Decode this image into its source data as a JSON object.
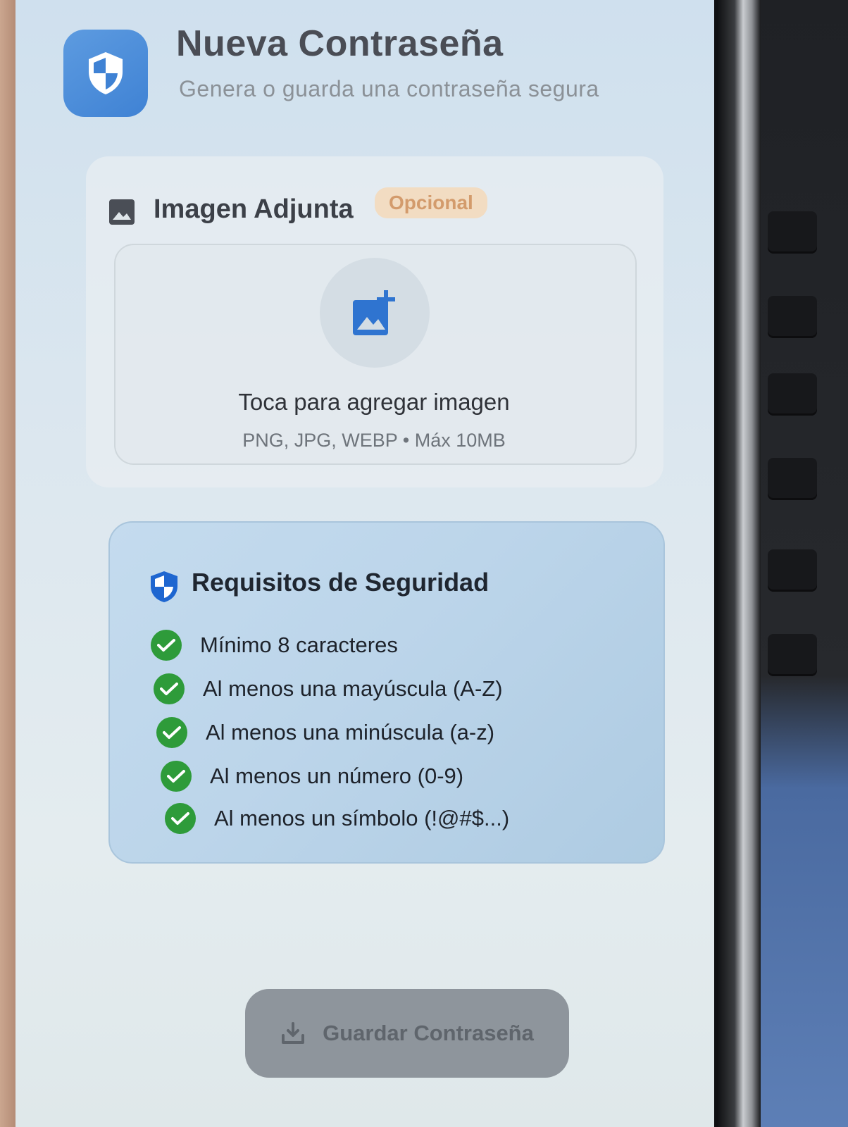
{
  "header": {
    "title": "Nueva Contraseña",
    "subtitle": "Genera o guarda una contraseña segura",
    "icon": "shield-icon"
  },
  "attachment": {
    "title": "Imagen Adjunta",
    "badge": "Opcional",
    "dropzone_text": "Toca para agregar imagen",
    "dropzone_hint": "PNG, JPG, WEBP • Máx 10MB",
    "icon": "add-photo-icon"
  },
  "requirements": {
    "title": "Requisitos de Seguridad",
    "items": [
      "Mínimo 8 caracteres",
      "Al menos una mayúscula (A-Z)",
      "Al menos una minúscula (a-z)",
      "Al menos un número (0-9)",
      "Al menos un símbolo (!@#$...)"
    ]
  },
  "actions": {
    "save_label": "Guardar Contraseña"
  },
  "colors": {
    "accent": "#3f82d4",
    "check": "#2e9b3a",
    "badge_bg": "#f2dcc2",
    "badge_text": "#d39b6c"
  }
}
